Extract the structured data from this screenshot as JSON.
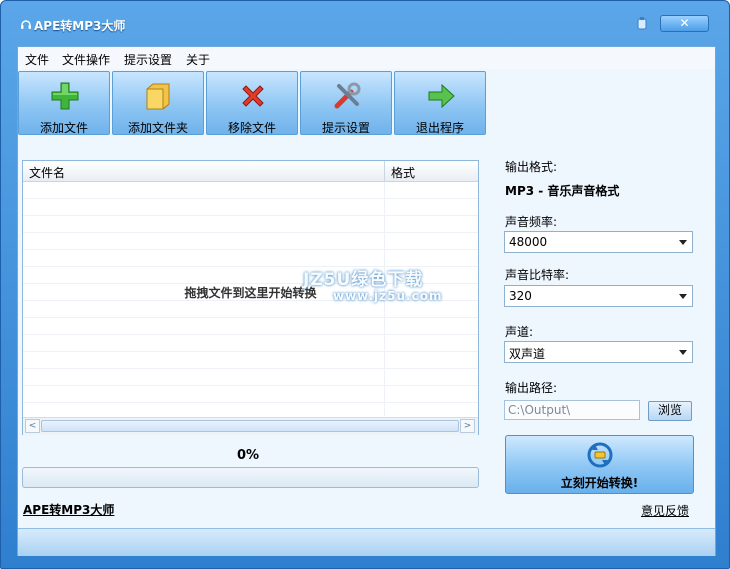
{
  "window": {
    "title": "APE转MP3大师",
    "close_glyph": "✕"
  },
  "menu": [
    "文件",
    "文件操作",
    "提示设置",
    "关于"
  ],
  "toolbar": [
    {
      "label": "添加文件",
      "icon": "add-icon"
    },
    {
      "label": "添加文件夹",
      "icon": "folder-icon"
    },
    {
      "label": "移除文件",
      "icon": "remove-icon"
    },
    {
      "label": "提示设置",
      "icon": "tools-icon"
    },
    {
      "label": "退出程序",
      "icon": "exit-arrow-icon"
    }
  ],
  "filelist": {
    "columns": [
      "文件名",
      "格式"
    ],
    "drop_hint": "拖拽文件到这里开始转换",
    "scroll_left": "<",
    "scroll_right": ">"
  },
  "progress": {
    "text": "0%",
    "value": 0
  },
  "footer": {
    "app_link": "APE转MP3大师",
    "feedback": "意见反馈"
  },
  "settings": {
    "output_format_label": "输出格式:",
    "output_format_value": "MP3 - 音乐声音格式",
    "sample_rate_label": "声音频率:",
    "sample_rate_value": "48000",
    "bitrate_label": "声音比特率:",
    "bitrate_value": "320",
    "channel_label": "声道:",
    "channel_value": "双声道",
    "output_path_label": "输出路径:",
    "output_path_value": "C:\\Output\\",
    "browse_label": "浏览"
  },
  "convert_button": {
    "label": "立刻开始转换!"
  },
  "watermark": {
    "line1": "JZ5U绿色下载",
    "line2": "www.jz5u.com"
  }
}
